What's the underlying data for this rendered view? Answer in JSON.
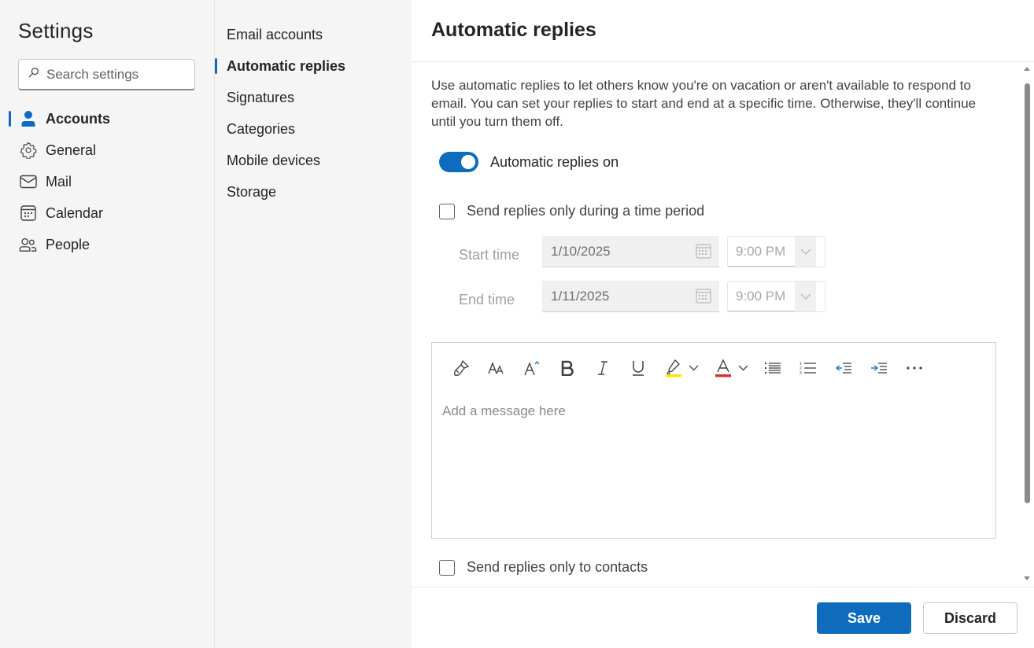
{
  "nav": {
    "title": "Settings",
    "search_placeholder": "Search settings",
    "items": [
      {
        "label": "Accounts",
        "icon": "person-icon",
        "active": true
      },
      {
        "label": "General",
        "icon": "gear-icon",
        "active": false
      },
      {
        "label": "Mail",
        "icon": "mail-icon",
        "active": false
      },
      {
        "label": "Calendar",
        "icon": "calendar-icon",
        "active": false
      },
      {
        "label": "People",
        "icon": "people-icon",
        "active": false
      }
    ]
  },
  "subnav": {
    "items": [
      {
        "label": "Email accounts",
        "active": false
      },
      {
        "label": "Automatic replies",
        "active": true
      },
      {
        "label": "Signatures",
        "active": false
      },
      {
        "label": "Categories",
        "active": false
      },
      {
        "label": "Mobile devices",
        "active": false
      },
      {
        "label": "Storage",
        "active": false
      }
    ]
  },
  "main": {
    "title": "Automatic replies",
    "description": "Use automatic replies to let others know you're on vacation or aren't available to respond to email. You can set your replies to start and end at a specific time. Otherwise, they'll continue until you turn them off.",
    "toggle": {
      "label": "Automatic replies on",
      "on": true
    },
    "time_period_checkbox": {
      "label": "Send replies only during a time period",
      "checked": false
    },
    "start": {
      "label": "Start time",
      "date": "1/10/2025",
      "time": "9:00 PM"
    },
    "end": {
      "label": "End time",
      "date": "1/11/2025",
      "time": "9:00 PM"
    },
    "editor": {
      "placeholder": "Add a message here",
      "toolbar": [
        "format-painter-icon",
        "font-size-icon",
        "grow-font-icon",
        "bold-icon",
        "italic-icon",
        "underline-icon",
        "highlight-icon",
        "font-color-icon",
        "bullets-icon",
        "numbering-icon",
        "decrease-indent-icon",
        "increase-indent-icon",
        "more-options-icon"
      ]
    },
    "contacts_checkbox": {
      "label": "Send replies only to contacts",
      "checked": false
    }
  },
  "footer": {
    "save_label": "Save",
    "discard_label": "Discard"
  },
  "colors": {
    "accent": "#0f6cbd",
    "highlight": "#ffe600",
    "font_color": "#d13438"
  }
}
